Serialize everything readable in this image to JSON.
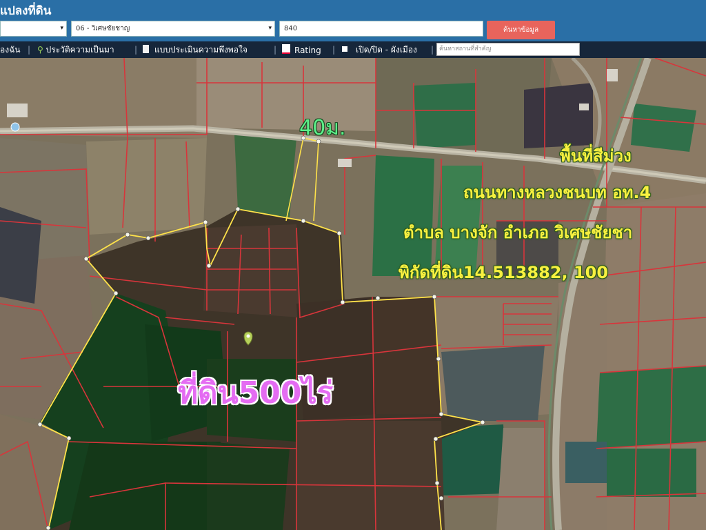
{
  "header": {
    "title": "แปลงที่ดิน",
    "district_select": "",
    "subdistrict_select": "06 - วิเศษชัยชาญ",
    "parcel_number": "840",
    "search_button": "ค้นหาข้อมูล"
  },
  "toolbar": {
    "items": [
      {
        "label": "องฉัน",
        "icon": "none"
      },
      {
        "label": "ประวัติความเป็นมา",
        "icon": "tree-icon"
      },
      {
        "label": "แบบประเมินความพึงพอใจ",
        "icon": "document-icon"
      },
      {
        "label": "Rating",
        "icon": "chart-icon"
      },
      {
        "label": "เปิด/ปิด - ผังเมือง",
        "icon": "square-icon"
      }
    ],
    "place_search_placeholder": "ค้นหาสถานที่สำคัญ"
  },
  "map": {
    "road_width_label": "40ม.",
    "land_label": "ที่ดิน500ไร่",
    "info_lines": [
      "พื้นที่สีม่วง",
      "ถนนทางหลวงชนบท อท.4",
      "ตำบล บางจัก อำเภอ วิเศษชัยชา",
      "พิกัดที่ดิน14.513882, 100"
    ],
    "colors": {
      "parcel_border": "#d8353b",
      "selection_border": "#ffe24a",
      "title_bar": "#2a6fa6",
      "toolbar": "#16263a",
      "search_button": "#e8645c"
    }
  }
}
